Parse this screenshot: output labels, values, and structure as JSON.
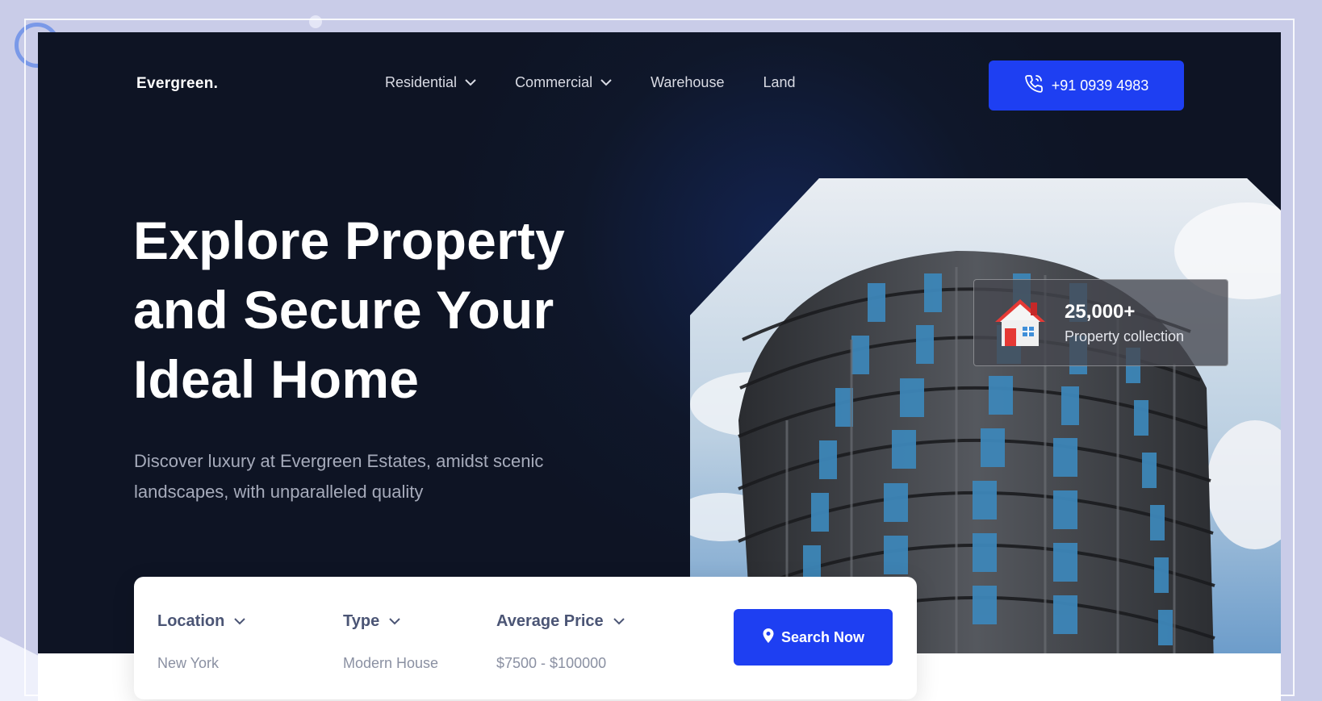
{
  "brand": {
    "logo": "Evergreen."
  },
  "nav": {
    "items": [
      {
        "label": "Residential",
        "has_dropdown": true
      },
      {
        "label": "Commercial",
        "has_dropdown": true
      },
      {
        "label": "Warehouse",
        "has_dropdown": false
      },
      {
        "label": "Land",
        "has_dropdown": false
      }
    ],
    "phone": {
      "label": "+91 0939 4983",
      "icon": "phone-icon"
    }
  },
  "hero": {
    "headline": [
      "Explore Property",
      "and Secure Your",
      "Ideal Home"
    ],
    "subtext": "Discover luxury at Evergreen Estates, amidst scenic landscapes, with unparalleled quality"
  },
  "stat": {
    "value": "25,000+",
    "label": "Property collection",
    "icon": "house-icon"
  },
  "search": {
    "fields": [
      {
        "label": "Location",
        "value": "New York"
      },
      {
        "label": "Type",
        "value": "Modern House"
      },
      {
        "label": "Average Price",
        "value": "$7500 - $100000"
      }
    ],
    "button": {
      "label": "Search Now",
      "icon": "location-pin-icon"
    }
  },
  "colors": {
    "accent": "#1e3ff2",
    "hero_bg": "#0f172a",
    "page_bg": "#c9cce8"
  }
}
